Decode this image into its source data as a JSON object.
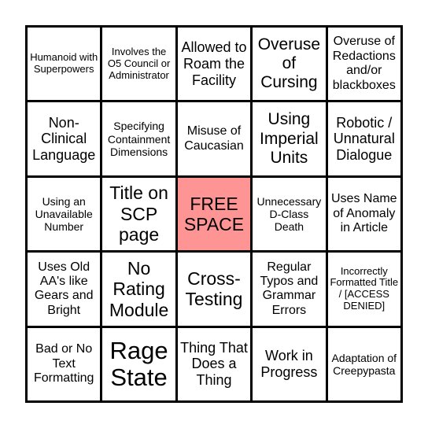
{
  "board": {
    "free_space_color": "#ff9494",
    "cells": [
      "Humanoid with Superpowers",
      "Involves the O5 Council or Administrator",
      "Allowed to Roam the Facility",
      "Overuse of Cursing",
      "Overuse of Redactions and/or blackboxes",
      "Non-Clinical Language",
      "Specifying Containment Dimensions",
      "Misuse of Caucasian",
      "Using Imperial Units",
      "Robotic / Unnatural Dialogue",
      "Using an Unavailable Number",
      "Title on SCP page",
      "FREE SPACE",
      "Unnecessary D-Class Death",
      "Uses Name of Anomaly in Article",
      "Uses Old AA's like Gears and Bright",
      "No Rating Module",
      "Cross-Testing",
      "Regular Typos and Grammar Errors",
      "Incorrectly Formatted Title / [ACCESS DENIED]",
      "Bad or No Text Formatting",
      "Rage State",
      "Thing That Does a Thing",
      "Work in Progress",
      "Adaptation of Creepypasta"
    ]
  }
}
